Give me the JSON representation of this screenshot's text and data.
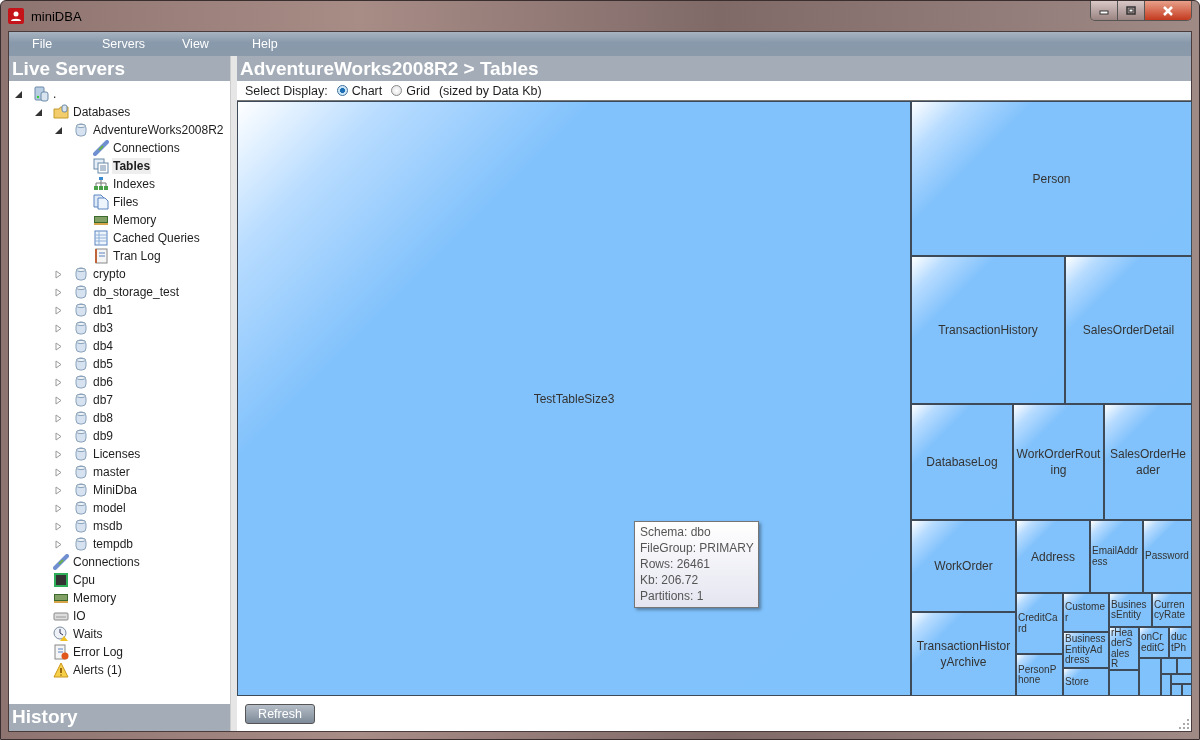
{
  "window": {
    "title": "miniDBA"
  },
  "menu": [
    "File",
    "Servers",
    "View",
    "Help"
  ],
  "sidebar": {
    "title": "Live Servers",
    "footer_title": "History",
    "tree": [
      {
        "label": ".",
        "kind": "server",
        "expanded": true,
        "selected": false,
        "children": [
          {
            "label": "Databases",
            "kind": "folder",
            "expanded": true,
            "selected": false,
            "children": [
              {
                "label": "AdventureWorks2008R2",
                "kind": "database",
                "expanded": true,
                "selected": false,
                "children": [
                  {
                    "label": "Connections",
                    "kind": "connections",
                    "selected": false
                  },
                  {
                    "label": "Tables",
                    "kind": "tables",
                    "selected": true
                  },
                  {
                    "label": "Indexes",
                    "kind": "indexes",
                    "selected": false
                  },
                  {
                    "label": "Files",
                    "kind": "files",
                    "selected": false
                  },
                  {
                    "label": "Memory",
                    "kind": "memory",
                    "selected": false
                  },
                  {
                    "label": "Cached Queries",
                    "kind": "queries",
                    "selected": false
                  },
                  {
                    "label": "Tran Log",
                    "kind": "log",
                    "selected": false
                  }
                ]
              },
              {
                "label": "crypto",
                "kind": "database",
                "expanded": false,
                "selected": false
              },
              {
                "label": "db_storage_test",
                "kind": "database",
                "expanded": false,
                "selected": false
              },
              {
                "label": "db1",
                "kind": "database",
                "expanded": false,
                "selected": false
              },
              {
                "label": "db3",
                "kind": "database",
                "expanded": false,
                "selected": false
              },
              {
                "label": "db4",
                "kind": "database",
                "expanded": false,
                "selected": false
              },
              {
                "label": "db5",
                "kind": "database",
                "expanded": false,
                "selected": false
              },
              {
                "label": "db6",
                "kind": "database",
                "expanded": false,
                "selected": false
              },
              {
                "label": "db7",
                "kind": "database",
                "expanded": false,
                "selected": false
              },
              {
                "label": "db8",
                "kind": "database",
                "expanded": false,
                "selected": false
              },
              {
                "label": "db9",
                "kind": "database",
                "expanded": false,
                "selected": false
              },
              {
                "label": "Licenses",
                "kind": "database",
                "expanded": false,
                "selected": false
              },
              {
                "label": "master",
                "kind": "database",
                "expanded": false,
                "selected": false
              },
              {
                "label": "MiniDba",
                "kind": "database",
                "expanded": false,
                "selected": false
              },
              {
                "label": "model",
                "kind": "database",
                "expanded": false,
                "selected": false
              },
              {
                "label": "msdb",
                "kind": "database",
                "expanded": false,
                "selected": false
              },
              {
                "label": "tempdb",
                "kind": "database",
                "expanded": false,
                "selected": false
              }
            ]
          },
          {
            "label": "Connections",
            "kind": "connections",
            "selected": false
          },
          {
            "label": "Cpu",
            "kind": "cpu",
            "selected": false
          },
          {
            "label": "Memory",
            "kind": "memory",
            "selected": false
          },
          {
            "label": "IO",
            "kind": "io",
            "selected": false
          },
          {
            "label": "Waits",
            "kind": "waits",
            "selected": false
          },
          {
            "label": "Error Log",
            "kind": "errorlog",
            "selected": false
          },
          {
            "label": "Alerts (1)",
            "kind": "alerts",
            "selected": false
          }
        ]
      }
    ]
  },
  "main": {
    "title": "AdventureWorks2008R2 > Tables",
    "display_label": "Select Display:",
    "display_options": [
      {
        "label": "Chart",
        "selected": true
      },
      {
        "label": "Grid",
        "selected": false
      }
    ],
    "display_note": "(sized by Data Kb)",
    "treemap": [
      "TestTableSize3",
      "Person",
      "TransactionHistory",
      "SalesOrderDetail",
      "DatabaseLog",
      "WorkOrderRouting",
      "SalesOrderHeader",
      "WorkOrder",
      "TransactionHistoryArchive",
      "Address",
      "EmailAddress",
      "Password",
      "CreditCard",
      "PersonPhone",
      "Customer",
      "BusinessEntityAddress",
      "Store",
      "BusinessEntity",
      "CurrencyRate",
      "rHeaderSalesR",
      "onCreditC",
      "ductPh"
    ],
    "tooltip": [
      "Schema: dbo",
      "FileGroup: PRIMARY",
      "Rows: 26461",
      "Kb: 206.72",
      "Partitions: 1"
    ],
    "refresh_button": "Refresh"
  }
}
